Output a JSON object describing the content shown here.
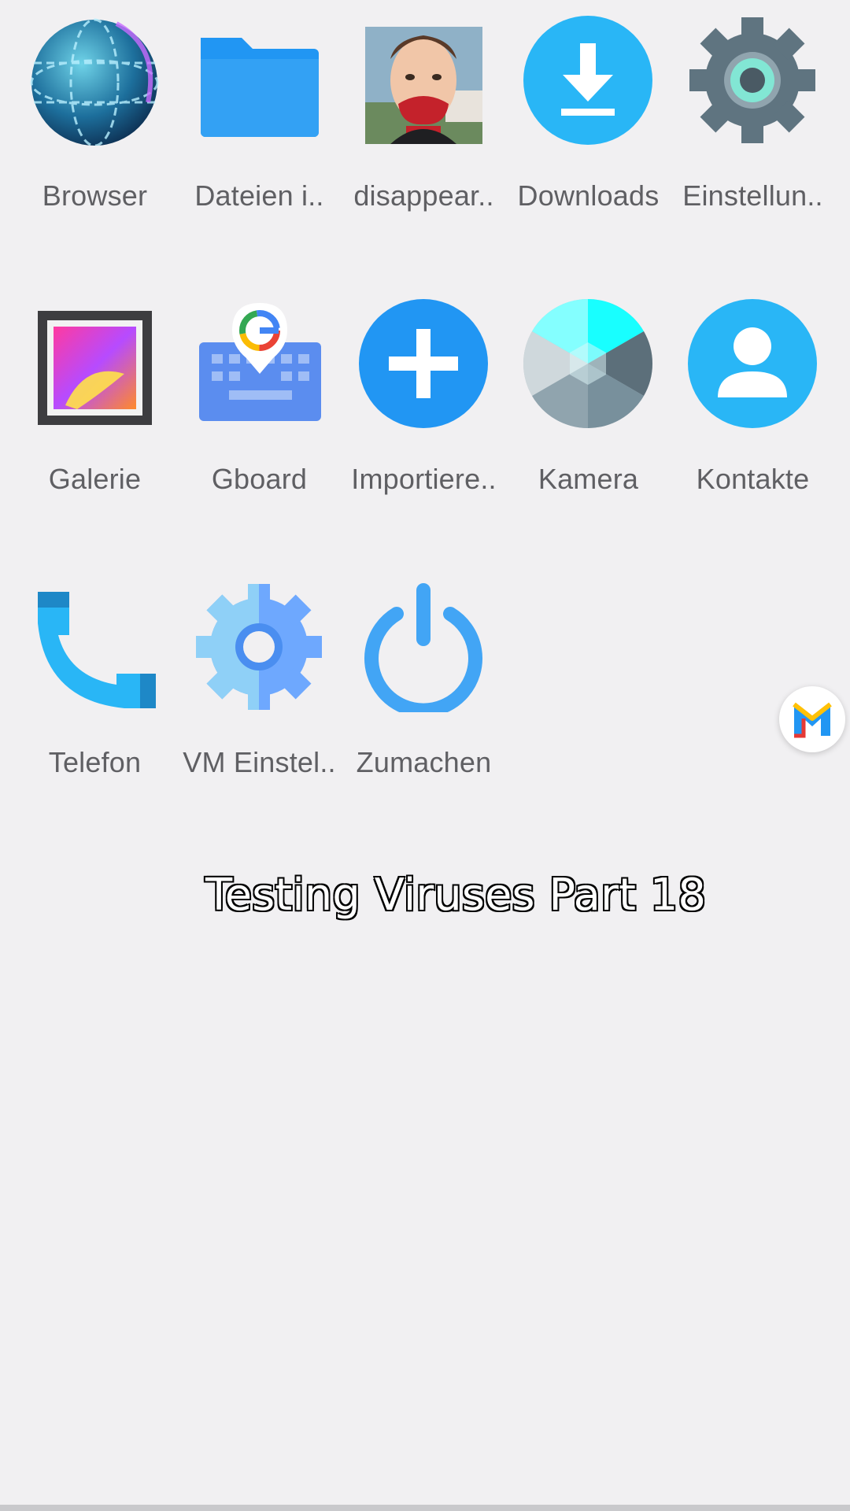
{
  "apps": [
    {
      "label": "Browser",
      "icon": "globe-icon"
    },
    {
      "label": "Dateien i..",
      "icon": "folder-icon"
    },
    {
      "label": "disappear..",
      "icon": "character-face-icon"
    },
    {
      "label": "Downloads",
      "icon": "download-icon"
    },
    {
      "label": "Einstellun..",
      "icon": "settings-gear-icon"
    },
    {
      "label": "Galerie",
      "icon": "gallery-icon"
    },
    {
      "label": "Gboard",
      "icon": "gboard-icon"
    },
    {
      "label": "Importiere..",
      "icon": "plus-icon"
    },
    {
      "label": "Kamera",
      "icon": "camera-shutter-icon"
    },
    {
      "label": "Kontakte",
      "icon": "contact-person-icon"
    },
    {
      "label": "Telefon",
      "icon": "phone-icon"
    },
    {
      "label": "VM Einstel..",
      "icon": "vm-settings-gear-icon"
    },
    {
      "label": "Zumachen",
      "icon": "power-icon"
    }
  ],
  "overlay_caption": "Testing Viruses Part 18",
  "floating_button": {
    "icon": "m-logo-icon"
  },
  "colors": {
    "background": "#f1f0f2",
    "label": "#5f5f63",
    "blue": "#2196f3",
    "light_blue": "#29b6f6"
  }
}
